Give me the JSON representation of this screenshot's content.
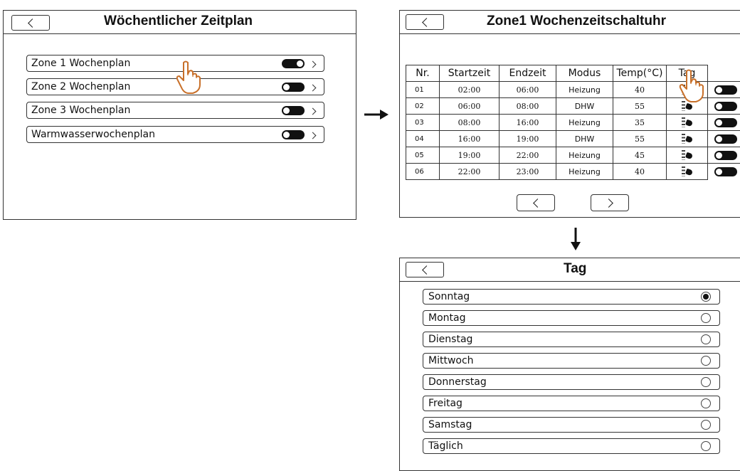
{
  "panel_weekly": {
    "title": "Wöchentlicher Zeitplan",
    "items": [
      {
        "label": "Zone 1 Wochenplan",
        "toggle": "on"
      },
      {
        "label": "Zone 2 Wochenplan",
        "toggle": "off"
      },
      {
        "label": "Zone 3 Wochenplan",
        "toggle": "off"
      },
      {
        "label": "Warmwasserwochenplan",
        "toggle": "off"
      }
    ]
  },
  "panel_zone_timer": {
    "title": "Zone1 Wochenzeitschaltuhr",
    "columns": [
      "Nr.",
      "Startzeit",
      "Endzeit",
      "Modus",
      "Temp(°C)",
      "Tag",
      ""
    ],
    "rows": [
      {
        "nr": "01",
        "start": "02:00",
        "end": "06:00",
        "mode": "Heizung",
        "temp": "40",
        "toggle": "off"
      },
      {
        "nr": "02",
        "start": "06:00",
        "end": "08:00",
        "mode": "DHW",
        "temp": "55",
        "toggle": "off"
      },
      {
        "nr": "03",
        "start": "08:00",
        "end": "16:00",
        "mode": "Heizung",
        "temp": "35",
        "toggle": "off"
      },
      {
        "nr": "04",
        "start": "16:00",
        "end": "19:00",
        "mode": "DHW",
        "temp": "55",
        "toggle": "off"
      },
      {
        "nr": "05",
        "start": "19:00",
        "end": "22:00",
        "mode": "Heizung",
        "temp": "45",
        "toggle": "off"
      },
      {
        "nr": "06",
        "start": "22:00",
        "end": "23:00",
        "mode": "Heizung",
        "temp": "40",
        "toggle": "off"
      }
    ]
  },
  "panel_day": {
    "title": "Tag",
    "days": [
      {
        "label": "Sonntag",
        "selected": true
      },
      {
        "label": "Montag",
        "selected": false
      },
      {
        "label": "Dienstag",
        "selected": false
      },
      {
        "label": "Mittwoch",
        "selected": false
      },
      {
        "label": "Donnerstag",
        "selected": false
      },
      {
        "label": "Freitag",
        "selected": false
      },
      {
        "label": "Samstag",
        "selected": false
      },
      {
        "label": "Täglich",
        "selected": false
      }
    ]
  },
  "icons": [
    "chevron-left-icon",
    "chevron-right-icon",
    "toggle-icon",
    "day-select-hand-icon",
    "pointing-hand-icon",
    "arrow-right-icon",
    "arrow-down-icon",
    "radio-icon"
  ]
}
